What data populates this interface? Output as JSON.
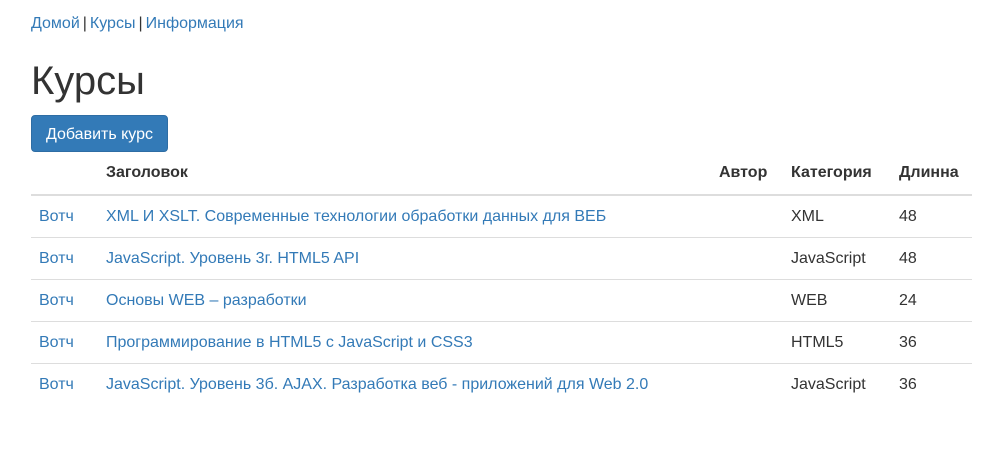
{
  "nav": {
    "home": "Домой",
    "courses": "Курсы",
    "info": "Информация",
    "separator": "|"
  },
  "page": {
    "title": "Курсы",
    "add_button": "Добавить курс"
  },
  "table": {
    "headers": {
      "watch": "",
      "title": "Заголовок",
      "author": "Автор",
      "category": "Категория",
      "length": "Длинна"
    },
    "rows": [
      {
        "watch": "Вотч",
        "title": "XML И XSLT. Современные технологии обработки данных для ВЕБ",
        "author": "",
        "category": "XML",
        "length": "48"
      },
      {
        "watch": "Вотч",
        "title": "JavaScript. Уровень 3г. HTML5 API",
        "author": "",
        "category": "JavaScript",
        "length": "48"
      },
      {
        "watch": "Вотч",
        "title": "Основы WEB – разработки",
        "author": "",
        "category": "WEB",
        "length": "24"
      },
      {
        "watch": "Вотч",
        "title": "Программирование в HTML5 с JavaScript и CSS3",
        "author": "",
        "category": "HTML5",
        "length": "36"
      },
      {
        "watch": "Вотч",
        "title": "JavaScript. Уровень 3б. AJAX. Разработка веб - приложений для Web 2.0",
        "author": "",
        "category": "JavaScript",
        "length": "36"
      }
    ]
  },
  "colors": {
    "link": "#337ab7",
    "button_bg": "#337ab7",
    "text": "#333333",
    "border": "#dddddd"
  }
}
